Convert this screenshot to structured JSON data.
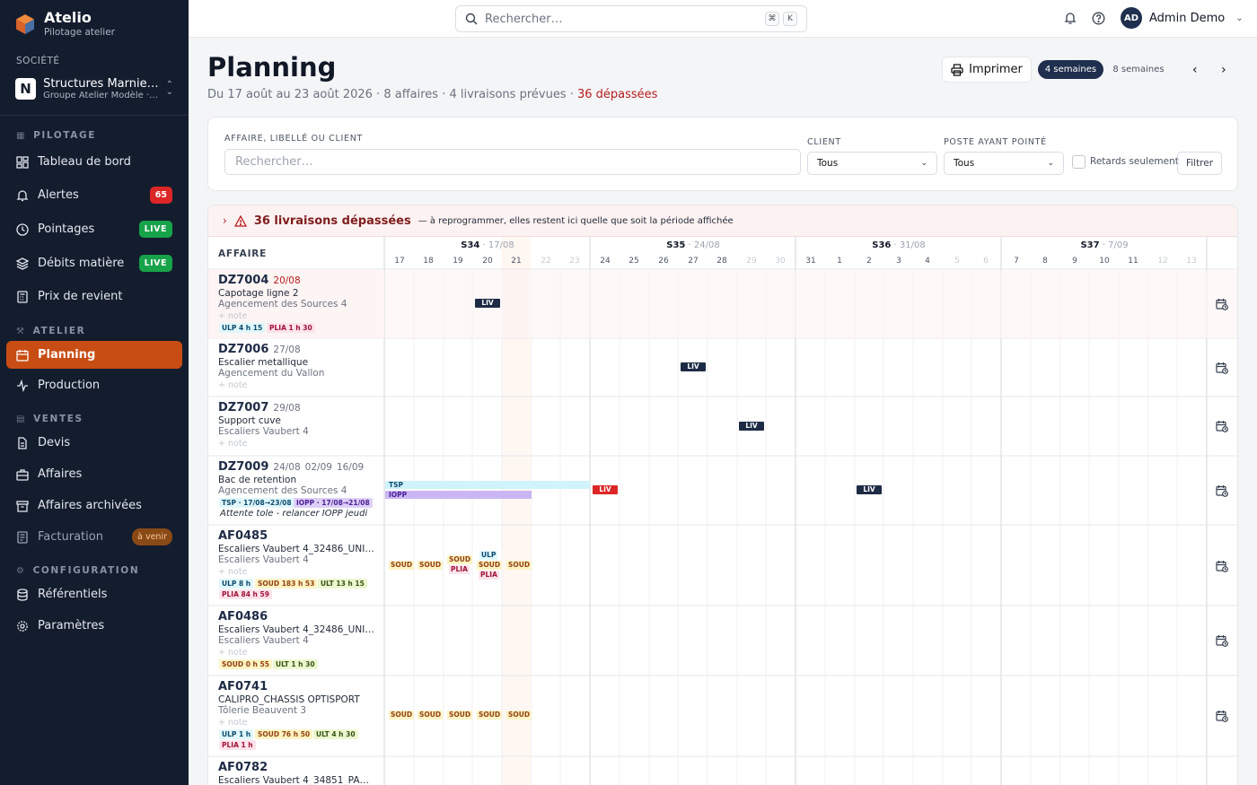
{
  "app": {
    "name": "Atelio",
    "tagline": "Pilotage atelier"
  },
  "sidebar": {
    "company_label": "SOCIÉTÉ",
    "company_name": "Structures Marnie…",
    "company_group": "Groupe Atelier Modèle ·…",
    "company_initial": "N",
    "groups": {
      "pilotage": "PILOTAGE",
      "atelier": "ATELIER",
      "ventes": "VENTES",
      "configuration": "CONFIGURATION"
    },
    "items": {
      "dashboard": "Tableau de bord",
      "alerts": "Alertes",
      "alerts_badge": "65",
      "pointages": "Pointages",
      "pointages_badge": "LIVE",
      "debits": "Débits matière",
      "debits_badge": "LIVE",
      "prix": "Prix de revient",
      "planning": "Planning",
      "production": "Production",
      "devis": "Devis",
      "affaires": "Affaires",
      "archives": "Affaires archivées",
      "facturation": "Facturation",
      "facturation_badge": "à venir",
      "referentiels": "Référentiels",
      "parametres": "Paramètres"
    }
  },
  "topbar": {
    "search_placeholder": "Rechercher…",
    "kbd1": "⌘",
    "kbd2": "K",
    "user_initials": "AD",
    "user_name": "Admin Demo"
  },
  "page": {
    "title": "Planning",
    "subtitle": "Du 17 août au 23 août 2026 · 8 affaires · 4 livraisons prévues · ",
    "subtitle_over": "36 dépassées",
    "print": "Imprimer",
    "range_on": "4 semaines",
    "range_off": "8 semaines"
  },
  "filters": {
    "search_label": "AFFAIRE, LIBELLÉ OU CLIENT",
    "search_placeholder": "Rechercher…",
    "client_label": "CLIENT",
    "client_value": "Tous",
    "poste_label": "POSTE AYANT POINTÉ",
    "poste_value": "Tous",
    "late_only": "Retards seulement",
    "filter_btn": "Filtrer"
  },
  "banner": {
    "title": "36 livraisons dépassées",
    "text": "— à reprogrammer, elles restent ici quelle que soit la période affichée"
  },
  "grid": {
    "col_header": "AFFAIRE",
    "weeks": [
      {
        "label": "S34",
        "date": " · 17/08"
      },
      {
        "label": "S35",
        "date": " · 24/08"
      },
      {
        "label": "S36",
        "date": " · 31/08"
      },
      {
        "label": "S37",
        "date": " · 7/09"
      }
    ],
    "days": [
      "17",
      "18",
      "19",
      "20",
      "21",
      "22",
      "23",
      "24",
      "25",
      "26",
      "27",
      "28",
      "29",
      "30",
      "31",
      "1",
      "2",
      "3",
      "4",
      "5",
      "6",
      "7",
      "8",
      "9",
      "10",
      "11",
      "12",
      "13"
    ],
    "liv": "LIV",
    "tsp": "TSP",
    "iopp": "IOPP",
    "rows": [
      {
        "code": "DZ7004",
        "date": "20/08",
        "lib": "Capotage ligne 2",
        "client": "Agencement des Sources 4",
        "note": "+ note",
        "tags": [
          "ULP 4 h 15",
          "PLIA 1 h 30"
        ]
      },
      {
        "code": "DZ7006",
        "date": "27/08",
        "lib": "Escalier metallique",
        "client": "Agencement du Vallon",
        "note": "+ note"
      },
      {
        "code": "DZ7007",
        "date": "29/08",
        "lib": "Support cuve",
        "client": "Escaliers Vaubert 4",
        "note": "+ note"
      },
      {
        "code": "DZ7009",
        "date": "24/08",
        "date2": "02/09",
        "date3": "16/09",
        "lib": "Bac de retention",
        "client": "Agencement des Sources 4",
        "tags": [
          "TSP · 17/08→23/08",
          "IOPP · 17/08→21/08"
        ],
        "comment": "Attente tole - relancer IOPP jeudi"
      },
      {
        "code": "AF0485",
        "lib": "Escaliers Vaubert 4_32486_UNIVE…",
        "client": "Escaliers Vaubert 4",
        "note": "+ note",
        "tags": [
          "ULP 8 h",
          "SOUD 183 h 53",
          "ULT 13 h 15",
          "PLIA 84 h 59"
        ],
        "chips": [
          "SOUD",
          "SOUD",
          "SOUD",
          "PLIA",
          "ULP",
          "SOUD",
          "PLIA",
          "SOUD"
        ]
      },
      {
        "code": "AF0486",
        "lib": "Escaliers Vaubert 4_32486_UNIVE…",
        "client": "Escaliers Vaubert 4",
        "note": "+ note",
        "tags": [
          "SOUD 0 h 55",
          "ULT 1 h 30"
        ]
      },
      {
        "code": "AF0741",
        "lib": "CALIPRO_CHASSIS OPTISPORT",
        "client": "Tôlerie Beauvent 3",
        "note": "+ note",
        "tags": [
          "ULP 1 h",
          "SOUD 76 h 50",
          "ULT 4 h 30",
          "PLIA 1 h"
        ],
        "chips": [
          "SOUD",
          "SOUD",
          "SOUD",
          "SOUD",
          "SOUD"
        ]
      },
      {
        "code": "AF0782",
        "lib": "Escaliers Vaubert 4_34851_PADEL…"
      }
    ]
  },
  "colors": {
    "sidebar": "#141d2e",
    "accent": "#c84d14",
    "late": "#dc2626",
    "navy": "#1e2b45"
  }
}
